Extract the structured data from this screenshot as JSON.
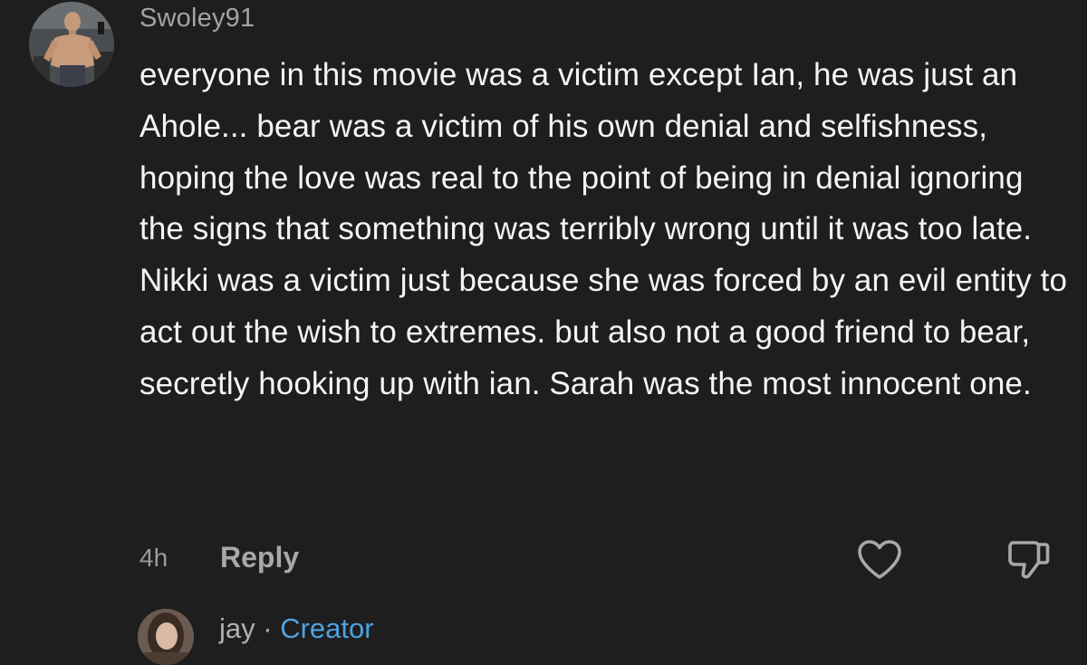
{
  "comment": {
    "username": "Swoley91",
    "text": "everyone in this movie was a victim except Ian, he was just an Ahole... bear was a victim of his own denial and selfishness, hoping the love was real to the point of being in denial ignoring the signs that something was terribly wrong until it was too late. Nikki was a victim just because she was forced by an evil entity to act out the wish to extremes. but also not a good friend to bear, secretly hooking up with ian. Sarah was the most innocent one.",
    "time": "4h",
    "reply_label": "Reply",
    "like_icon": "heart-outline-icon",
    "dislike_icon": "thumbs-down-icon"
  },
  "reply": {
    "username": "jay",
    "separator": "·",
    "badge": "Creator"
  },
  "colors": {
    "background": "#1e1e1e",
    "text": "#f4f4f4",
    "muted": "#a3a3a3",
    "creator_badge": "#4ba3e0"
  }
}
